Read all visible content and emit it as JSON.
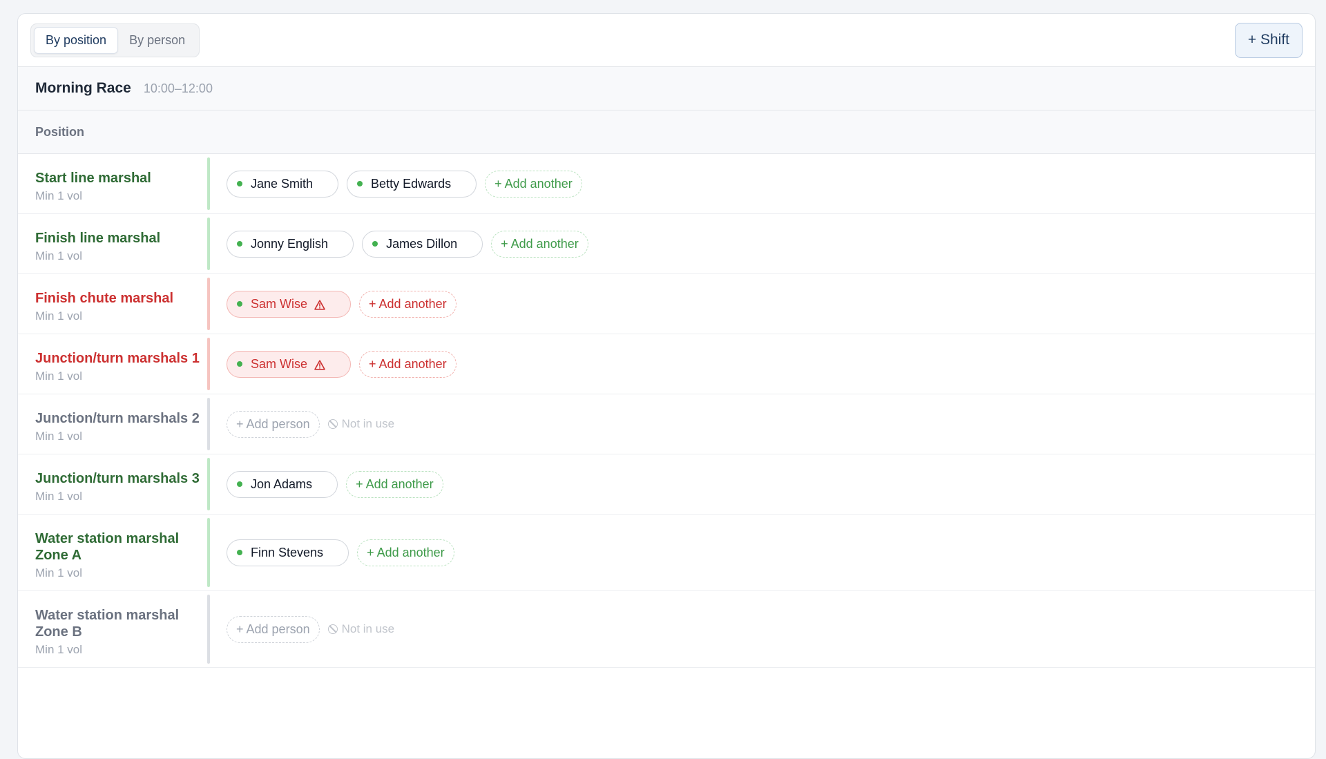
{
  "toolbar": {
    "view_tabs": [
      "By position",
      "By person"
    ],
    "add_shift_label": "+ Shift"
  },
  "shift": {
    "title": "Morning Race",
    "time": "10:00–12:00"
  },
  "table": {
    "column_header": "Position"
  },
  "colors": {
    "ok": "#2f6b35",
    "warning": "#cc3030",
    "inactive": "#6b7280",
    "accent": "#1e3a5f"
  },
  "icons": {
    "warning": "warning-triangle-icon",
    "not_in_use": "ban-icon"
  },
  "positions": [
    {
      "name": "Start line marshal",
      "min": "Min 1 vol",
      "status": "ok",
      "people": [
        "Jane Smith",
        "Betty Edwards"
      ],
      "action": "+ Add another",
      "note": ""
    },
    {
      "name": "Finish line marshal",
      "min": "Min 1 vol",
      "status": "ok",
      "people": [
        "Jonny English",
        "James Dillon"
      ],
      "action": "+ Add another",
      "note": ""
    },
    {
      "name": "Finish chute marshal",
      "min": "Min 1 vol",
      "status": "warn",
      "people": [
        "Sam Wise"
      ],
      "action": "+ Add another",
      "note": ""
    },
    {
      "name": "Junction/turn marshals 1",
      "min": "Min 1 vol",
      "status": "warn",
      "people": [
        "Sam Wise"
      ],
      "action": "+ Add another",
      "note": ""
    },
    {
      "name": "Junction/turn marshals 2",
      "min": "Min 1 vol",
      "status": "idle",
      "people": [],
      "action": "+ Add person",
      "note": "Not in use"
    },
    {
      "name": "Junction/turn marshals 3",
      "min": "Min 1 vol",
      "status": "ok",
      "people": [
        "Jon Adams"
      ],
      "action": "+ Add another",
      "note": ""
    },
    {
      "name": "Water station marshal Zone A",
      "min": "Min 1 vol",
      "status": "ok",
      "people": [
        "Finn Stevens"
      ],
      "action": "+ Add another",
      "note": ""
    },
    {
      "name": "Water station marshal Zone B",
      "min": "Min 1 vol",
      "status": "idle",
      "people": [],
      "action": "+ Add person",
      "note": "Not in use"
    }
  ]
}
